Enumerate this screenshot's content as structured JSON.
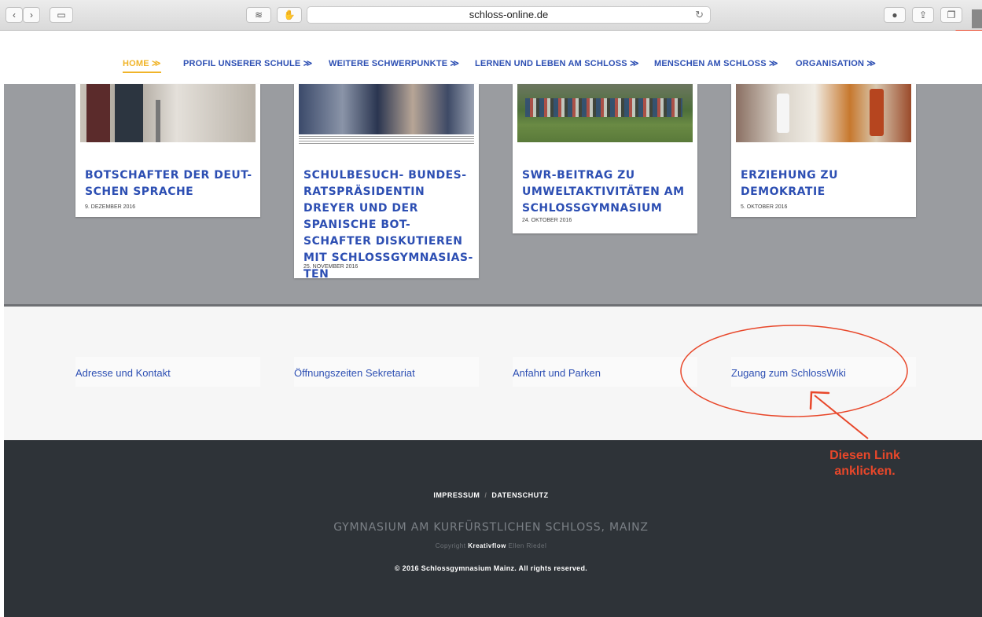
{
  "browser": {
    "url": "schloss-online.de",
    "reload_glyph": "↻",
    "icons": [
      "back-icon",
      "forward-icon",
      "sidebar-icon",
      "reader-icon",
      "extension-icon",
      "downloads-icon",
      "share-icon",
      "tabs-icon"
    ]
  },
  "nav": {
    "items": [
      {
        "label": "HOME ≫"
      },
      {
        "label": "PROFIL UNSERER SCHULE ≫"
      },
      {
        "label": "WEITERE SCHWERPUNKTE ≫"
      },
      {
        "label": "LERNEN UND LEBEN AM SCHLOSS ≫"
      },
      {
        "label": "MENSCHEN AM SCHLOSS ≫"
      },
      {
        "label": "ORGANISATION ≫"
      }
    ]
  },
  "posts": [
    {
      "title": "BOTSCHAFTER DER DEUT-SCHEN SPRACHE",
      "date": "9. DEZEMBER 2016"
    },
    {
      "title": "SCHULBESUCH- BUNDES-RATSPRÄSIDENTIN DREYER UND DER SPANISCHE BOT-SCHAFTER DISKUTIEREN MIT SCHLOSSGYMNASIAS-TEN",
      "date": "25. NOVEMBER 2016"
    },
    {
      "title": "SWR-BEITRAG ZU UMWELTAKTIVITÄTEN AM SCHLOSSGYMNASIUM",
      "date": "24. OKTOBER 2016"
    },
    {
      "title": "ERZIEHUNG ZU DEMOKRATIE",
      "date": "5. OKTOBER 2016"
    }
  ],
  "footer_links": [
    {
      "label": "Adresse und Kontakt"
    },
    {
      "label": "Öffnungszeiten Sekretariat"
    },
    {
      "label": "Anfahrt und Parken"
    },
    {
      "label": "Zugang zum SchlossWiki"
    }
  ],
  "footer": {
    "impressum": "IMPRESSUM",
    "separator": "/",
    "datenschutz": "DATENSCHUTZ",
    "school_name": "GYMNASIUM AM KURFÜRSTLICHEN SCHLOSS, MAINZ",
    "copyright_prefix": "Copyright",
    "brand": "Kreativflow",
    "author": "Ellen Riedel",
    "rights": "© 2016 Schlossgymnasium Mainz. All rights reserved."
  },
  "annotation": {
    "line1": "Diesen Link",
    "line2": "anklicken."
  },
  "colors": {
    "link_blue": "#2d4fb3",
    "active_yellow": "#f0b429",
    "annotation_red": "#e8472a",
    "footer_dark": "#2e3338"
  }
}
